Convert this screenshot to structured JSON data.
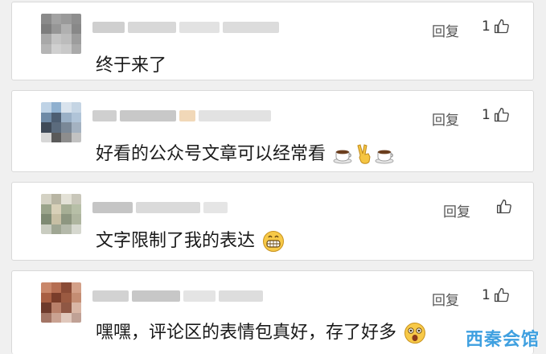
{
  "comments": [
    {
      "text": "终于来了",
      "reply_label": "回复",
      "like_count": "1",
      "emojis": []
    },
    {
      "text": "好看的公众号文章可以经常看",
      "reply_label": "回复",
      "like_count": "1",
      "emojis": [
        "coffee-icon",
        "victory-hand-icon",
        "coffee-icon"
      ]
    },
    {
      "text": "文字限制了我的表达",
      "reply_label": "回复",
      "like_count": "",
      "emojis": [
        "grin-emoji-icon"
      ]
    },
    {
      "text": "嘿嘿，评论区的表情包真好，存了好多",
      "reply_label": "回复",
      "like_count": "1",
      "emojis": [
        "astonished-emoji-icon"
      ]
    }
  ],
  "watermark": "西秦会馆",
  "colors": {
    "background": "#f0f0f0",
    "card": "#ffffff",
    "text": "#1a1a1a",
    "watermark": "#3fa0e0"
  }
}
